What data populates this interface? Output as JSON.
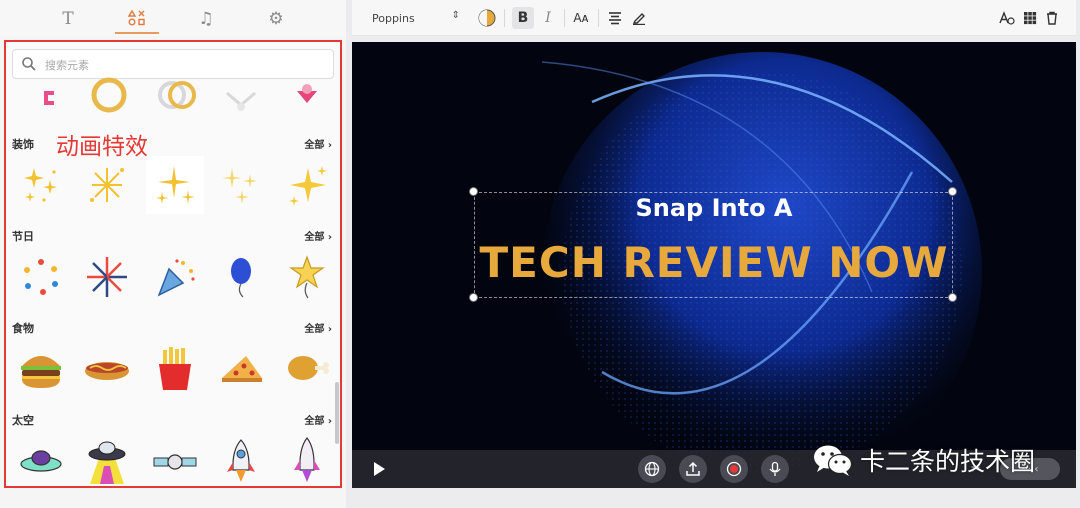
{
  "sidebar_tabs": [
    {
      "name": "text",
      "icon": "text-icon",
      "glyph": "T",
      "active": false
    },
    {
      "name": "elements",
      "icon": "shapes-icon",
      "active": true
    },
    {
      "name": "music",
      "icon": "music-icon",
      "glyph": "♫",
      "active": false
    },
    {
      "name": "settings",
      "icon": "gear-icon",
      "glyph": "⚙",
      "active": false
    }
  ],
  "search": {
    "placeholder": "搜索元素"
  },
  "annotation": "动画特效",
  "sections": [
    {
      "title": "装饰",
      "all_label": "全部"
    },
    {
      "title": "节日",
      "all_label": "全部"
    },
    {
      "title": "食物",
      "all_label": "全部"
    },
    {
      "title": "太空",
      "all_label": "全部"
    }
  ],
  "toolbar": {
    "font": "Poppins",
    "bold": "B",
    "italic": "I",
    "text_case": "Aᴀ"
  },
  "canvas": {
    "line1": "Snap Into A",
    "line2": "TECH REVIEW NOW"
  },
  "watermark": "卡二条的技术圈",
  "colors": {
    "accent": "#e59c5e",
    "annotation_red": "#e53935",
    "headline_gold": "#e8a93c"
  }
}
